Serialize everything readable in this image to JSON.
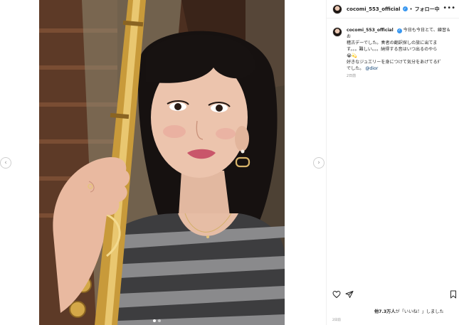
{
  "post": {
    "username": "cocomi_553_official",
    "separator": "•",
    "follow_label": "フォロー中",
    "more_label": "•••",
    "caption_lines": [
      "今日も今日とて、練習＆お",
      "稽古デーでした。奏者の翻訳探しの旅に出てま",
      "す。。。難しい。。。納得する音はいつ出るのやら",
      "😭💫"
    ],
    "caption_line2_a": "好きなジュエリーを身につけて気分をあげてるﾀﾞ",
    "caption_line2_b": "でした。",
    "mention": "@dior",
    "age": "2日前",
    "likes_text_prefix": "他7.3万人",
    "likes_text_suffix": "が「いいね！」しました",
    "date": "2日前"
  },
  "icons": {
    "prev": "chevron-left-icon",
    "next": "chevron-right-icon",
    "like": "heart-icon",
    "share": "send-icon",
    "save": "bookmark-icon",
    "verified": "verified-badge-icon"
  },
  "carousel": {
    "count": 2,
    "active": 0
  },
  "colors": {
    "verified": "#3897f0",
    "mention": "#00376b",
    "muted": "#8e8e8e"
  }
}
